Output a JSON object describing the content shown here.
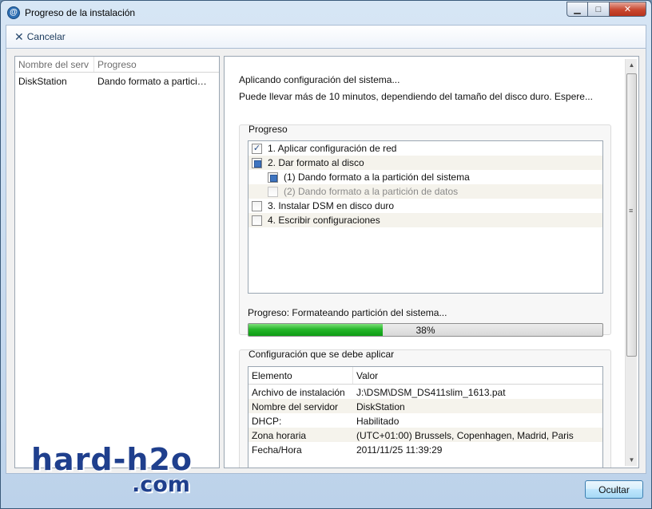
{
  "window": {
    "title": "Progreso de la instalación",
    "min_symbol": "▁",
    "max_symbol": "□",
    "close_symbol": "✕"
  },
  "toolbar": {
    "cancel_label": "Cancelar",
    "cancel_icon": "tools-cross-icon"
  },
  "server_list": {
    "columns": [
      "Nombre del serv",
      "Progreso"
    ],
    "rows": [
      {
        "name": "DiskStation",
        "progress": "Dando formato a partici…"
      }
    ]
  },
  "details": {
    "status": "Aplicando configuración del sistema...",
    "note": "Puede llevar más de 10 minutos, dependiendo del tamaño del disco duro. Espere...",
    "progress_group": {
      "title": "Progreso",
      "steps": [
        {
          "label": "1. Aplicar configuración de red",
          "state": "checked"
        },
        {
          "label": "2. Dar formato al disco",
          "state": "partial"
        },
        {
          "label": "(1) Dando formato a la partición del sistema",
          "state": "partial"
        },
        {
          "label": "(2) Dando formato a la partición de datos",
          "state": "disabled"
        },
        {
          "label": "3. Instalar DSM en disco duro",
          "state": "unchecked"
        },
        {
          "label": "4. Escribir configuraciones",
          "state": "unchecked"
        }
      ],
      "progress_label": "Progreso: Formateando partición del sistema...",
      "progress_percent": 38,
      "progress_text": "38%"
    },
    "config_group": {
      "title": "Configuración que se debe aplicar",
      "columns": [
        "Elemento",
        "Valor"
      ],
      "rows": [
        {
          "item": "Archivo de instalación",
          "value": "J:\\DSM\\DSM_DS411slim_1613.pat"
        },
        {
          "item": "Nombre del servidor",
          "value": "DiskStation"
        },
        {
          "item": "DHCP:",
          "value": "Habilitado"
        },
        {
          "item": "Zona horaria",
          "value": "(UTC+01:00) Brussels, Copenhagen, Madrid, Paris"
        },
        {
          "item": "Fecha/Hora",
          "value": "2011/11/25 11:39:29"
        }
      ]
    }
  },
  "footer": {
    "hide_label": "Ocultar"
  },
  "watermark": {
    "line1": "hard-h2o",
    "line2": ".com"
  },
  "colors": {
    "progress_fill": "#26b62a",
    "close_button": "#c8472f",
    "watermark": "#1f3f8d"
  }
}
